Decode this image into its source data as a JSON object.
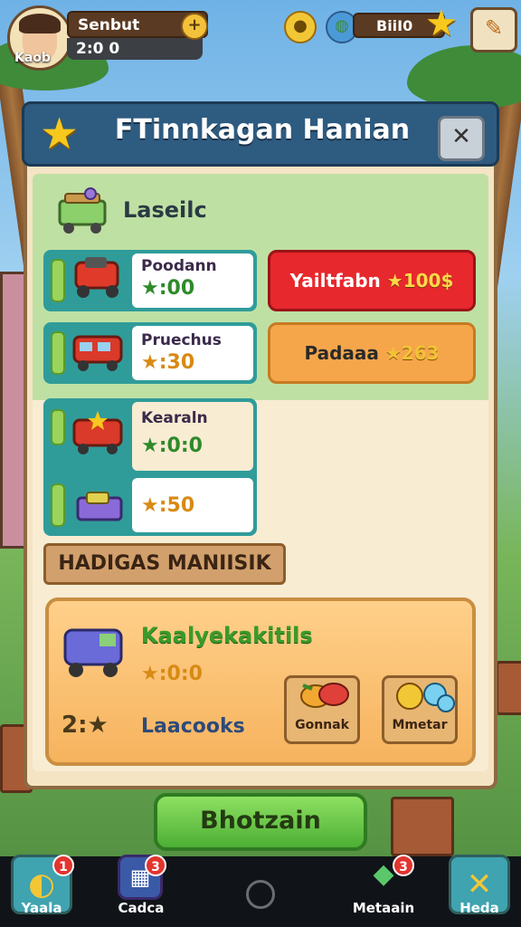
{
  "player": {
    "name": "Senbut",
    "score": "2:0 0",
    "level_tag": "Kaob"
  },
  "top_bar": {
    "plus_label": "+",
    "currency_label": "BiiI0"
  },
  "dialog": {
    "title": "FTinnkagan Hanian",
    "close_label": "✕",
    "section_title": "Laseilc",
    "items": [
      {
        "name": "Poodann",
        "price": "★:00"
      },
      {
        "name": "Pruechus",
        "price": "★:30"
      },
      {
        "name": "Kearaln",
        "price": "★:0:0"
      },
      {
        "name": "",
        "price": "★:50"
      }
    ],
    "buy_buttons": [
      {
        "label": "Yailtfabn",
        "price": "★100$"
      },
      {
        "label": "Padaaa",
        "price": "★263"
      }
    ],
    "ribbon_label": "HADIGAS MANIISIK",
    "featured": {
      "title": "Kaalyekakitils",
      "price": "★:0:0",
      "count": "2:★",
      "subtitle": "Laacooks",
      "actions": [
        {
          "label": "Gonnak"
        },
        {
          "label": "Mmetar"
        }
      ]
    },
    "primary_label": "Bhotzain"
  },
  "bottom_nav": [
    {
      "label": "Yaala",
      "badge": "1"
    },
    {
      "label": "Cadca",
      "badge": "3"
    },
    {
      "label": "Metaain",
      "badge": "3"
    },
    {
      "label": "Heda",
      "badge": ""
    }
  ],
  "colors": {
    "header": "#2e5b80",
    "buy_primary": "#e7282d",
    "buy_secondary": "#f5a64a",
    "confirm": "#4caf35"
  }
}
